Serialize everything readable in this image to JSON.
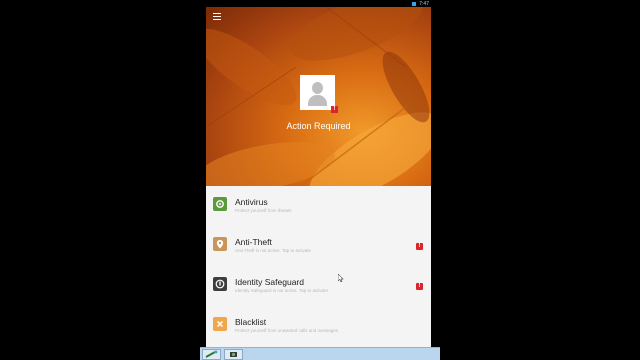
{
  "status_bar": {
    "time": "7:47"
  },
  "hero": {
    "status_text": "Action Required"
  },
  "features": [
    {
      "title": "Antivirus",
      "subtitle": "Protect yourself from threats",
      "icon": "antivirus-icon",
      "color": "#5b9a3c",
      "alert": false
    },
    {
      "title": "Anti-Theft",
      "subtitle": "Anti-Theft is not active. Tap to activate",
      "icon": "anti-theft-icon",
      "color": "#c9955a",
      "alert": true
    },
    {
      "title": "Identity Safeguard",
      "subtitle": "Identity Safeguard is not active. Tap to activate",
      "icon": "identity-safeguard-icon",
      "color": "#3d3d3d",
      "alert": true
    },
    {
      "title": "Blacklist",
      "subtitle": "Protect yourself from unwanted calls and messages",
      "icon": "blacklist-icon",
      "color": "#f0a64a",
      "alert": false
    }
  ],
  "badge_glyph": "!",
  "colors": {
    "alert": "#d9262c",
    "hero": "#d86b12"
  }
}
